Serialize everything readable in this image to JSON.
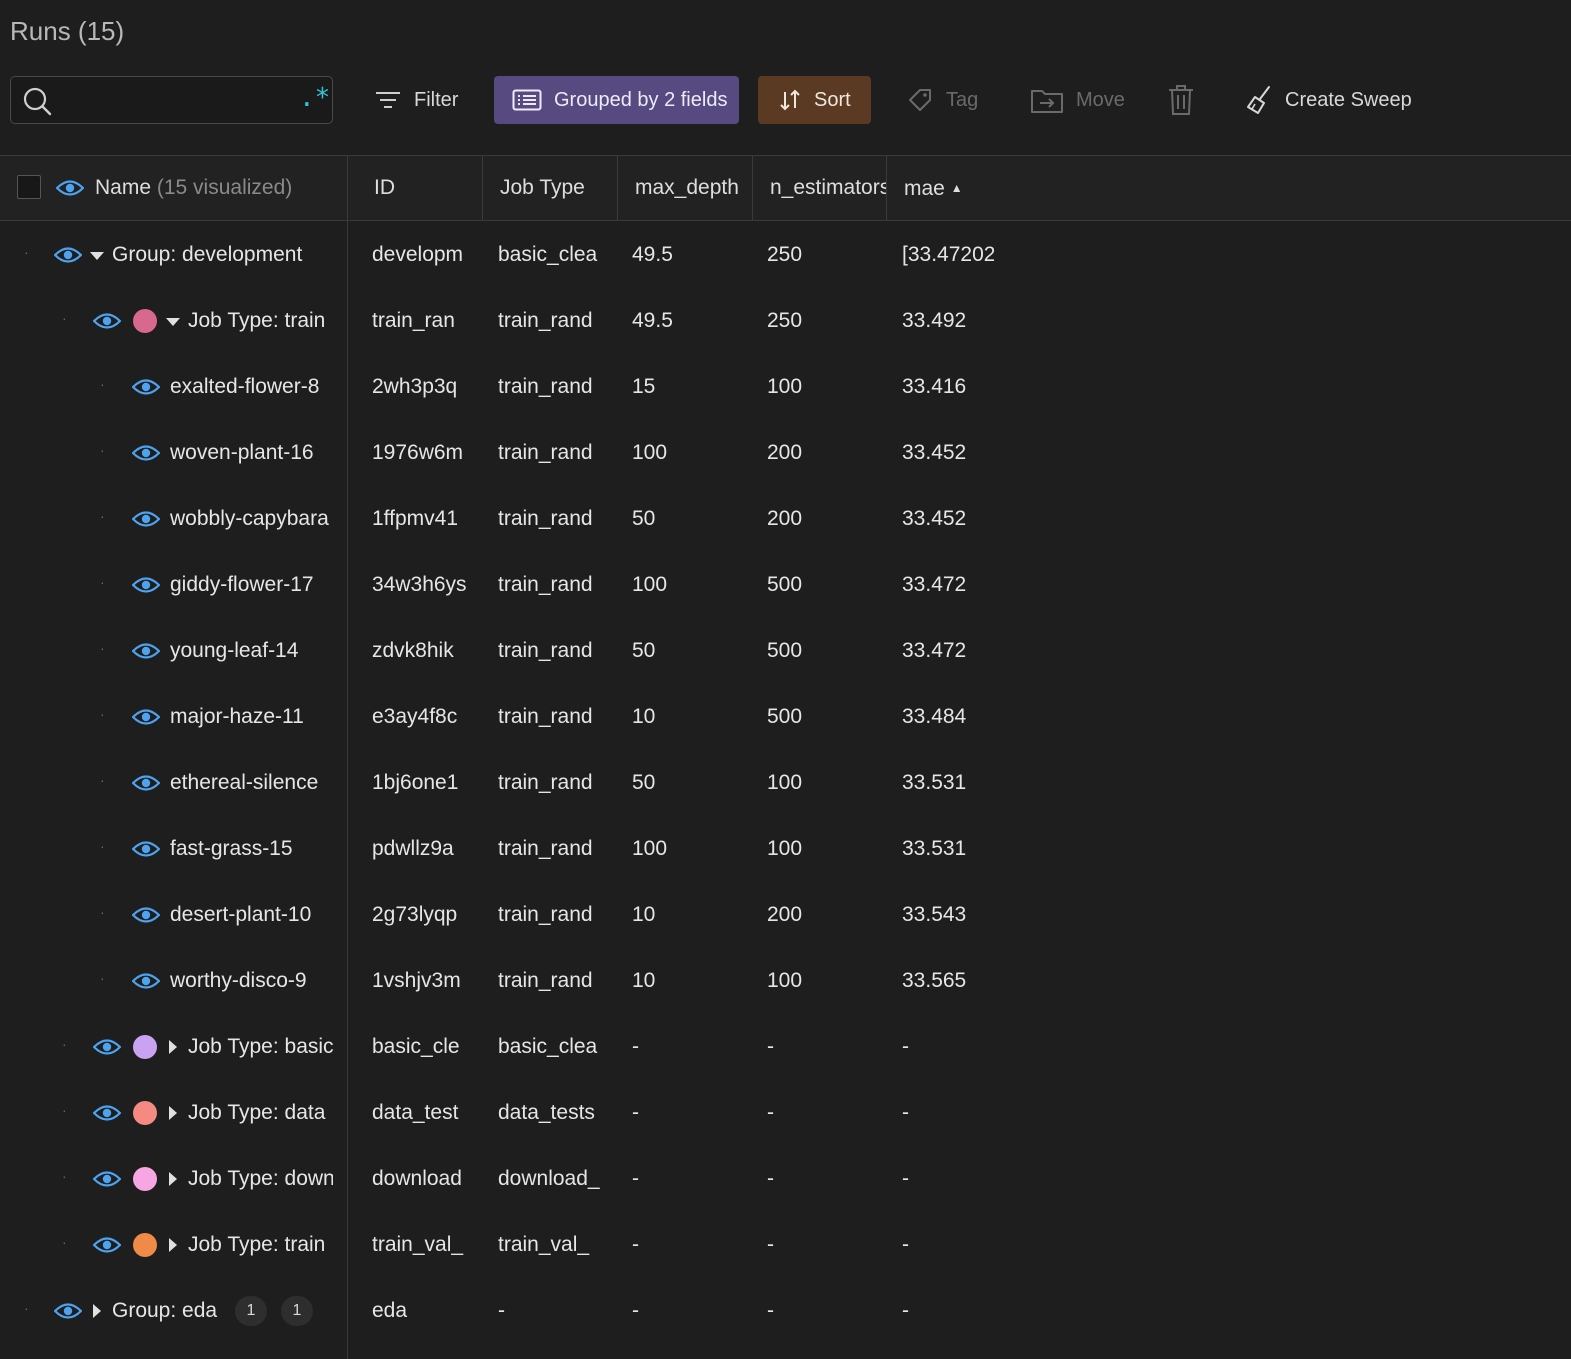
{
  "title": "Runs (15)",
  "search": {
    "value": "",
    "placeholder": "",
    "regex_icon": ".*"
  },
  "toolbar": {
    "filter": "Filter",
    "grouped": "Grouped by 2 fields",
    "sort": "Sort",
    "tag": "Tag",
    "move": "Move",
    "create_sweep": "Create Sweep"
  },
  "columns": {
    "name": "Name",
    "name_suffix": "(15 visualized)",
    "id": "ID",
    "job_type": "Job Type",
    "max_depth": "max_depth",
    "n_estimators": "n_estimators",
    "mae": "mae",
    "mae_sort": "▲"
  },
  "colors": {
    "accent_blue": "#4ea3f0",
    "group_button": "#574a80",
    "sort_button": "#5a3a22",
    "regex": "#2fc7d6"
  },
  "rows": [
    {
      "kind": "group",
      "level": 0,
      "expanded": true,
      "name": "Group: development",
      "id": "developm",
      "job_type": "basic_clea",
      "max_depth": "49.5",
      "n_estimators": "250",
      "mae": "[33.47202"
    },
    {
      "kind": "subgroup",
      "level": 1,
      "expanded": true,
      "color": "#d9688e",
      "name": "Job Type: train",
      "id": "train_ran",
      "job_type": "train_rand",
      "max_depth": "49.5",
      "n_estimators": "250",
      "mae": "33.492"
    },
    {
      "kind": "run",
      "level": 2,
      "name": "exalted-flower-8",
      "id": "2wh3p3q",
      "job_type": "train_rand",
      "max_depth": "15",
      "n_estimators": "100",
      "mae": "33.416"
    },
    {
      "kind": "run",
      "level": 2,
      "name": "woven-plant-16",
      "id": "1976w6m",
      "job_type": "train_rand",
      "max_depth": "100",
      "n_estimators": "200",
      "mae": "33.452"
    },
    {
      "kind": "run",
      "level": 2,
      "name": "wobbly-capybara",
      "id": "1ffpmv41",
      "job_type": "train_rand",
      "max_depth": "50",
      "n_estimators": "200",
      "mae": "33.452"
    },
    {
      "kind": "run",
      "level": 2,
      "name": "giddy-flower-17",
      "id": "34w3h6ys",
      "job_type": "train_rand",
      "max_depth": "100",
      "n_estimators": "500",
      "mae": "33.472"
    },
    {
      "kind": "run",
      "level": 2,
      "name": "young-leaf-14",
      "id": "zdvk8hik",
      "job_type": "train_rand",
      "max_depth": "50",
      "n_estimators": "500",
      "mae": "33.472"
    },
    {
      "kind": "run",
      "level": 2,
      "name": "major-haze-11",
      "id": "e3ay4f8c",
      "job_type": "train_rand",
      "max_depth": "10",
      "n_estimators": "500",
      "mae": "33.484"
    },
    {
      "kind": "run",
      "level": 2,
      "name": "ethereal-silence",
      "id": "1bj6one1",
      "job_type": "train_rand",
      "max_depth": "50",
      "n_estimators": "100",
      "mae": "33.531"
    },
    {
      "kind": "run",
      "level": 2,
      "name": "fast-grass-15",
      "id": "pdwllz9a",
      "job_type": "train_rand",
      "max_depth": "100",
      "n_estimators": "100",
      "mae": "33.531"
    },
    {
      "kind": "run",
      "level": 2,
      "name": "desert-plant-10",
      "id": "2g73lyqp",
      "job_type": "train_rand",
      "max_depth": "10",
      "n_estimators": "200",
      "mae": "33.543"
    },
    {
      "kind": "run",
      "level": 2,
      "name": "worthy-disco-9",
      "id": "1vshjv3m",
      "job_type": "train_rand",
      "max_depth": "10",
      "n_estimators": "100",
      "mae": "33.565"
    },
    {
      "kind": "subgroup",
      "level": 1,
      "expanded": false,
      "color": "#c9a3f2",
      "name": "Job Type: basic",
      "id": "basic_cle",
      "job_type": "basic_clea",
      "max_depth": "-",
      "n_estimators": "-",
      "mae": "-"
    },
    {
      "kind": "subgroup",
      "level": 1,
      "expanded": false,
      "color": "#f48a82",
      "name": "Job Type: data",
      "id": "data_test",
      "job_type": "data_tests",
      "max_depth": "-",
      "n_estimators": "-",
      "mae": "-"
    },
    {
      "kind": "subgroup",
      "level": 1,
      "expanded": false,
      "color": "#f7a6e4",
      "name": "Job Type: down",
      "id": "download",
      "job_type": "download_",
      "max_depth": "-",
      "n_estimators": "-",
      "mae": "-"
    },
    {
      "kind": "subgroup",
      "level": 1,
      "expanded": false,
      "color": "#f08a48",
      "name": "Job Type: train",
      "id": "train_val_",
      "job_type": "train_val_",
      "max_depth": "-",
      "n_estimators": "-",
      "mae": "-"
    },
    {
      "kind": "group",
      "level": 0,
      "expanded": false,
      "name": "Group: eda",
      "badges": [
        "1",
        "1"
      ],
      "id": "eda",
      "job_type": "-",
      "max_depth": "-",
      "n_estimators": "-",
      "mae": "-"
    }
  ]
}
